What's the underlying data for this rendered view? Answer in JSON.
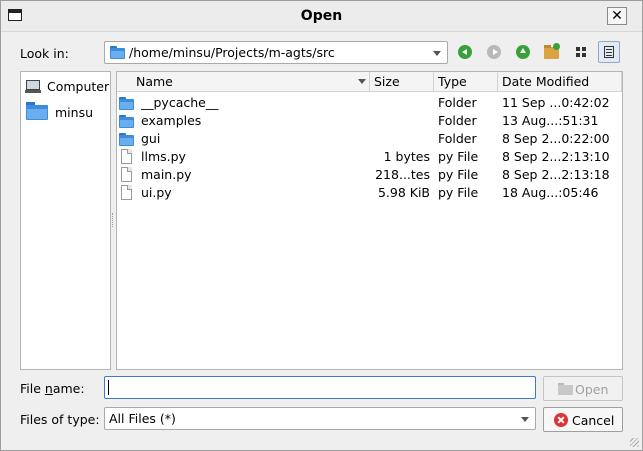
{
  "window": {
    "title": "Open",
    "close_glyph": "✕"
  },
  "lookin": {
    "label": "Look in:",
    "path": "/home/minsu/Projects/m-agts/src"
  },
  "toolbar": {
    "icons": [
      "back-icon",
      "forward-icon",
      "parent-directory-icon",
      "new-folder-icon",
      "list-view-icon",
      "detail-view-icon"
    ]
  },
  "sidebar": {
    "items": [
      {
        "label": "Computer",
        "icon": "computer-icon"
      },
      {
        "label": "minsu",
        "icon": "folder-icon"
      }
    ]
  },
  "columns": [
    "Name",
    "Size",
    "Type",
    "Date Modified"
  ],
  "files": [
    {
      "name": "__pycache__",
      "size": "",
      "type": "Folder",
      "date": "11 Sep ...0:42:02",
      "kind": "folder"
    },
    {
      "name": "examples",
      "size": "",
      "type": "Folder",
      "date": "13 Aug...:51:31",
      "kind": "folder"
    },
    {
      "name": "gui",
      "size": "",
      "type": "Folder",
      "date": "8 Sep 2...0:22:00",
      "kind": "folder"
    },
    {
      "name": "llms.py",
      "size": "1 bytes",
      "type": "py File",
      "date": "8 Sep 2...2:13:10",
      "kind": "file"
    },
    {
      "name": "main.py",
      "size": "218...tes",
      "type": "py File",
      "date": "8 Sep 2...2:13:18",
      "kind": "file"
    },
    {
      "name": "ui.py",
      "size": "5.98 KiB",
      "type": "py File",
      "date": "18 Aug...:05:46",
      "kind": "file"
    }
  ],
  "filename": {
    "label_pre": "File ",
    "label_mnemonic": "n",
    "label_post": "ame:",
    "value": ""
  },
  "filetype": {
    "label": "Files of type:",
    "value": "All Files (*)"
  },
  "buttons": {
    "open": "Open",
    "cancel": "Cancel"
  },
  "colors": {
    "accent": "#3a7bd5",
    "folder": "#3d8ddd",
    "nav_green": "#3aa03a"
  }
}
